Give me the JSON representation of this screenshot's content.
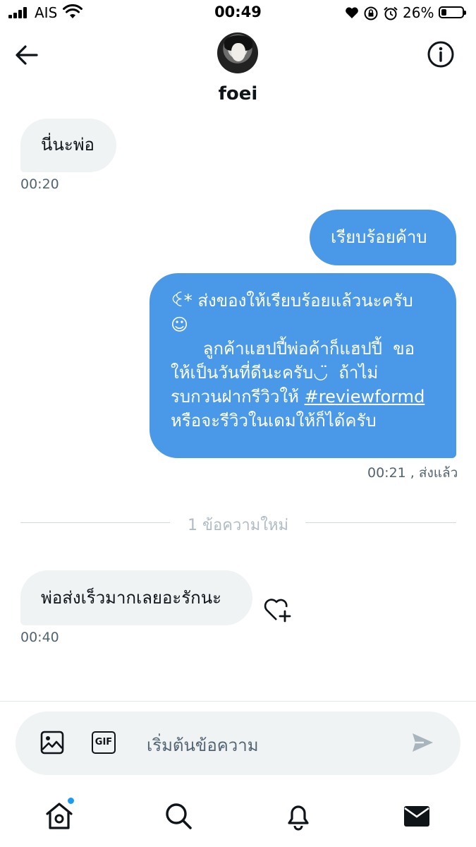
{
  "status_bar": {
    "carrier": "AIS",
    "time": "00:49",
    "battery_percent": "26%",
    "battery_level": 0.26
  },
  "header": {
    "name": "foei",
    "back_icon": "arrow-left-icon",
    "info_icon": "info-icon"
  },
  "messages": [
    {
      "text": "นี่นะพ่อ",
      "time": "00:20"
    },
    {
      "text": "เรียบร้อยค้าบ"
    },
    {
      "lines": [
        "ꒊ* ส่งของให้เรียบร้อยแล้วนะครับ",
        "☺︎",
        "      ลูกค้าแฮปปี้พ่อค้าก็แฮปปี้  ขอ",
        "ให้เป็นวันที่ดีนะครับ◡̈  ถ้าไม่",
        "รบกวนฝากรีวิวให้ ",
        "หรือจะรีวิวในเดมให้ก็ได้ครับ"
      ],
      "hashtag": "#reviewformd",
      "time": "00:21 , ส่งแล้ว"
    },
    {
      "text": "พ่อส่งเร็วมากเลยอะรักนะ",
      "time": "00:40"
    }
  ],
  "divider": {
    "label": "1 ข้อความใหม่"
  },
  "composer": {
    "placeholder": "เริ่มต้นข้อความ",
    "gif_label": "GIF"
  },
  "tab_bar": {
    "items": [
      "home-icon",
      "search-icon",
      "bell-icon",
      "mail-icon"
    ]
  },
  "colors": {
    "accent": "#1d9bf0",
    "outgoing_bubble": "#4a99e9",
    "incoming_bubble": "#eff3f4"
  }
}
